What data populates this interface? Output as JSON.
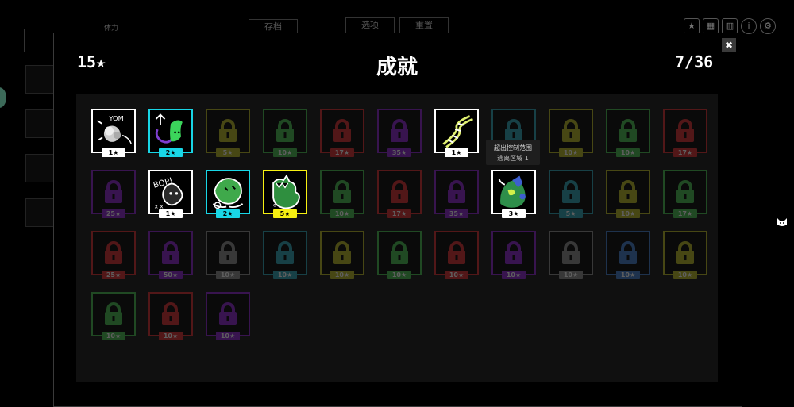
{
  "background_ui": {
    "tabs": [
      "存档",
      "选项",
      "重置"
    ],
    "top_icons": [
      "star-icon",
      "grid-icon",
      "chart-icon",
      "info-icon",
      "settings-icon"
    ],
    "tab_label_small": "体力"
  },
  "modal": {
    "stars_total": "15★",
    "title": "成就",
    "progress": "7/36",
    "close_label": "✖"
  },
  "colors": {
    "white": "#ffffff",
    "cyan": "#19d6e6",
    "yellow": "#f5ef12",
    "red": "#d8262a",
    "purple": "#8a1fcf",
    "green": "#43bd4a",
    "lightgreen": "#7bd23a",
    "olive": "#b7b81d",
    "gray": "#8a8a8a",
    "teal": "#28a3b4",
    "blue": "#3b79c9"
  },
  "achievements": [
    {
      "stars": "1★",
      "color": "white",
      "unlocked": true,
      "art": "bubble"
    },
    {
      "stars": "2★",
      "color": "cyan",
      "unlocked": true,
      "art": "blob"
    },
    {
      "stars": "5★",
      "color": "olive",
      "unlocked": false
    },
    {
      "stars": "10★",
      "color": "green",
      "unlocked": false
    },
    {
      "stars": "17★",
      "color": "red",
      "unlocked": false
    },
    {
      "stars": "35★",
      "color": "purple",
      "unlocked": false
    },
    {
      "stars": "1★",
      "color": "white",
      "unlocked": true,
      "art": "dna"
    },
    {
      "stars": "",
      "color": "teal",
      "unlocked": false
    },
    {
      "stars": "10★",
      "color": "olive",
      "unlocked": false
    },
    {
      "stars": "10★",
      "color": "green",
      "unlocked": false
    },
    {
      "stars": "17★",
      "color": "red",
      "unlocked": false
    },
    {
      "stars": "25★",
      "color": "purple",
      "unlocked": false
    },
    {
      "stars": "1★",
      "color": "white",
      "unlocked": true,
      "art": "bop"
    },
    {
      "stars": "2★",
      "color": "cyan",
      "unlocked": true,
      "art": "frog"
    },
    {
      "stars": "5★",
      "color": "yellow",
      "unlocked": true,
      "art": "monster"
    },
    {
      "stars": "10★",
      "color": "green",
      "unlocked": false
    },
    {
      "stars": "17★",
      "color": "red",
      "unlocked": false
    },
    {
      "stars": "35★",
      "color": "purple",
      "unlocked": false
    },
    {
      "stars": "3★",
      "color": "white",
      "unlocked": true,
      "art": "creature"
    },
    {
      "stars": "5★",
      "color": "teal",
      "unlocked": false
    },
    {
      "stars": "10★",
      "color": "olive",
      "unlocked": false
    },
    {
      "stars": "17★",
      "color": "green",
      "unlocked": false
    },
    {
      "stars": "25★",
      "color": "red",
      "unlocked": false
    },
    {
      "stars": "50★",
      "color": "purple",
      "unlocked": false
    },
    {
      "stars": "10★",
      "color": "gray",
      "unlocked": false
    },
    {
      "stars": "10★",
      "color": "teal",
      "unlocked": false
    },
    {
      "stars": "10★",
      "color": "olive",
      "unlocked": false
    },
    {
      "stars": "10★",
      "color": "green",
      "unlocked": false
    },
    {
      "stars": "10★",
      "color": "red",
      "unlocked": false
    },
    {
      "stars": "10★",
      "color": "purple",
      "unlocked": false
    },
    {
      "stars": "10★",
      "color": "gray",
      "unlocked": false
    },
    {
      "stars": "10★",
      "color": "blue",
      "unlocked": false
    },
    {
      "stars": "10★",
      "color": "olive",
      "unlocked": false
    },
    {
      "stars": "10★",
      "color": "green",
      "unlocked": false
    },
    {
      "stars": "10★",
      "color": "red",
      "unlocked": false
    },
    {
      "stars": "10★",
      "color": "purple",
      "unlocked": false
    }
  ],
  "tooltip": {
    "title": "超出控制范围",
    "subtitle": "逃离区域 1"
  }
}
